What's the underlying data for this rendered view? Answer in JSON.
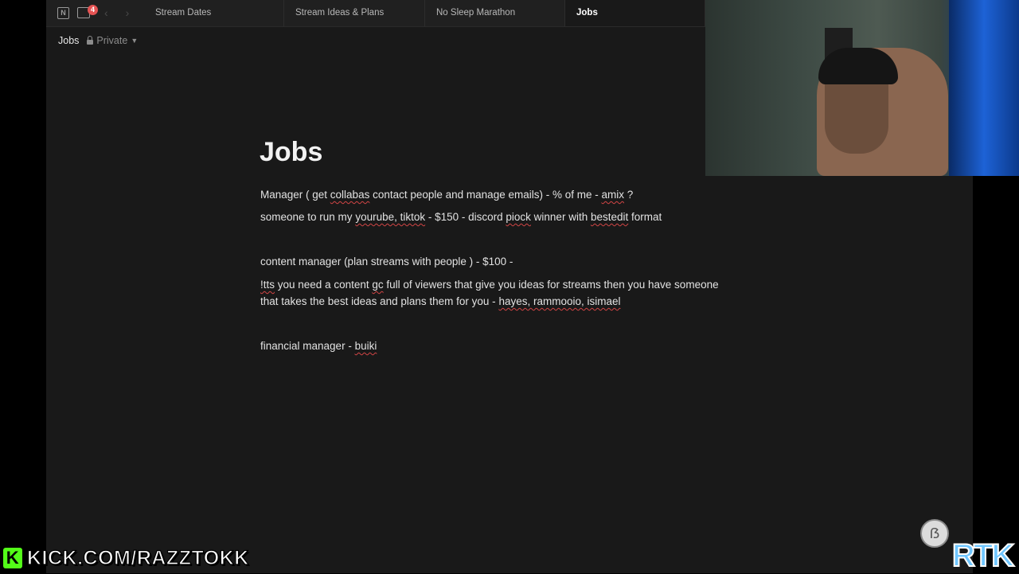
{
  "tabbar": {
    "inbox_badge": "4",
    "tabs": [
      {
        "label": "Stream Dates"
      },
      {
        "label": "Stream Ideas & Plans"
      },
      {
        "label": "No Sleep Marathon"
      },
      {
        "label": "Jobs"
      }
    ]
  },
  "breadcrumb": {
    "title": "Jobs",
    "privacy": "Private"
  },
  "page": {
    "title": "Jobs",
    "lines": {
      "l1": {
        "a": "Manager ( get ",
        "b": "collabas",
        "c": " contact people and manage emails)  - % of me  - ",
        "d": "amix",
        "e": " ?"
      },
      "l2": {
        "a": "someone to run my ",
        "b": "yourube, tiktok",
        "c": "  - $150 - discord ",
        "d": "piock",
        "e": " winner with ",
        "f": "bestedit",
        "g": " format"
      },
      "l3": "content manager (plan streams with people ) - $100 -",
      "l4": {
        "a": "!tts",
        "b": " you need a content ",
        "c": "gc",
        "d": " full of viewers that give you ideas for streams then you have someone"
      },
      "l5": {
        "a": "that takes the best ideas and plans them for you - ",
        "b": "hayes, rammooio, isimael"
      },
      "l6": {
        "a": "financial manager - ",
        "b": "buiki"
      }
    }
  },
  "overlay": {
    "kick_url": "KICK.COM/RAZZTOKK",
    "kick_logo": "K",
    "rtk": "RTK",
    "colors": {
      "kick_green": "#53fc18",
      "rtk_blue": "#6fc6ff"
    }
  },
  "colors": {
    "badge": "#e55353",
    "spellcheck": "#d24545",
    "background": "#191919"
  }
}
